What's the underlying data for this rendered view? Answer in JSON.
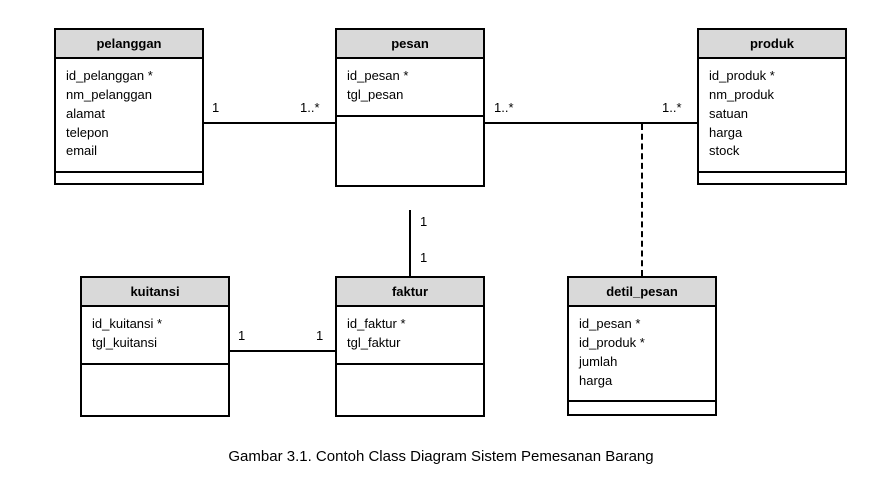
{
  "classes": {
    "pelanggan": {
      "name": "pelanggan",
      "attrs": [
        "id_pelanggan *",
        "nm_pelanggan",
        "alamat",
        "telepon",
        "email"
      ]
    },
    "pesan": {
      "name": "pesan",
      "attrs": [
        "id_pesan *",
        "tgl_pesan"
      ]
    },
    "produk": {
      "name": "produk",
      "attrs": [
        "id_produk *",
        "nm_produk",
        "satuan",
        "harga",
        "stock"
      ]
    },
    "kuitansi": {
      "name": "kuitansi",
      "attrs": [
        "id_kuitansi *",
        "tgl_kuitansi"
      ]
    },
    "faktur": {
      "name": "faktur",
      "attrs": [
        "id_faktur *",
        "tgl_faktur"
      ]
    },
    "detil_pesan": {
      "name": "detil_pesan",
      "attrs": [
        "id_pesan *",
        "id_produk *",
        "jumlah",
        "harga"
      ]
    }
  },
  "mult": {
    "pelanggan_pesan_left": "1",
    "pelanggan_pesan_right": "1..*",
    "pesan_produk_left": "1..*",
    "pesan_produk_right": "1..*",
    "pesan_faktur_top": "1",
    "pesan_faktur_bottom": "1",
    "kuitansi_faktur_left": "1",
    "kuitansi_faktur_right": "1"
  },
  "caption": "Gambar 3.1. Contoh Class Diagram Sistem Pemesanan Barang",
  "chart_data": {
    "type": "table",
    "diagram_type": "UML class diagram",
    "title": "Gambar 3.1. Contoh Class Diagram Sistem Pemesanan Barang",
    "classes": [
      {
        "name": "pelanggan",
        "attributes": [
          "id_pelanggan *",
          "nm_pelanggan",
          "alamat",
          "telepon",
          "email"
        ],
        "operations": []
      },
      {
        "name": "pesan",
        "attributes": [
          "id_pesan *",
          "tgl_pesan"
        ],
        "operations": []
      },
      {
        "name": "produk",
        "attributes": [
          "id_produk *",
          "nm_produk",
          "satuan",
          "harga",
          "stock"
        ],
        "operations": []
      },
      {
        "name": "kuitansi",
        "attributes": [
          "id_kuitansi *",
          "tgl_kuitansi"
        ],
        "operations": []
      },
      {
        "name": "faktur",
        "attributes": [
          "id_faktur *",
          "tgl_faktur"
        ],
        "operations": []
      },
      {
        "name": "detil_pesan",
        "attributes": [
          "id_pesan *",
          "id_produk *",
          "jumlah",
          "harga"
        ],
        "operations": []
      }
    ],
    "associations": [
      {
        "from": "pelanggan",
        "to": "pesan",
        "from_multiplicity": "1",
        "to_multiplicity": "1..*",
        "style": "solid"
      },
      {
        "from": "pesan",
        "to": "produk",
        "from_multiplicity": "1..*",
        "to_multiplicity": "1..*",
        "style": "solid",
        "association_class": "detil_pesan"
      },
      {
        "from": "pesan",
        "to": "faktur",
        "from_multiplicity": "1",
        "to_multiplicity": "1",
        "style": "solid"
      },
      {
        "from": "kuitansi",
        "to": "faktur",
        "from_multiplicity": "1",
        "to_multiplicity": "1",
        "style": "solid"
      }
    ]
  }
}
